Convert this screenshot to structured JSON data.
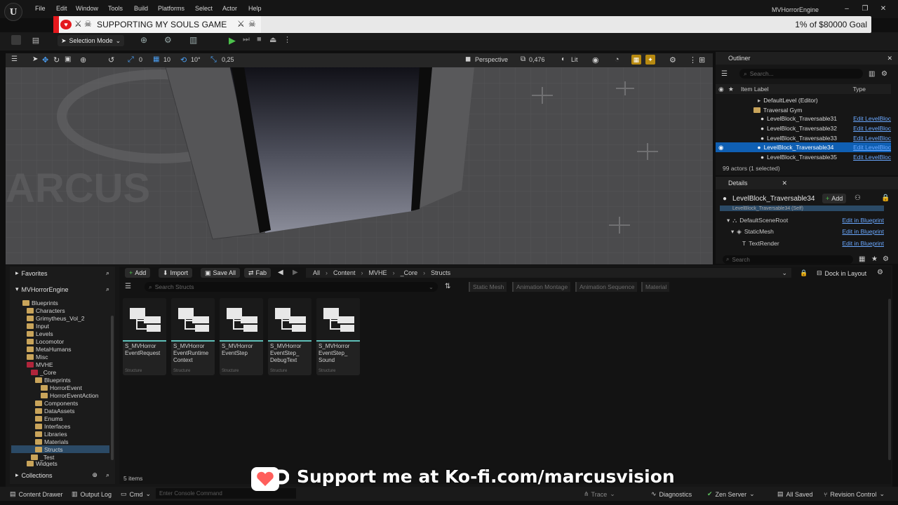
{
  "menu": {
    "items": [
      "File",
      "Edit",
      "Window",
      "Tools",
      "Build",
      "Platforms",
      "Select",
      "Actor",
      "Help"
    ],
    "app_title": "MVHorrorEngine"
  },
  "banner": {
    "title": "SUPPORTING MY SOULS GAME",
    "goal": "1% of $80000 Goal",
    "colors": {
      "accent": "#e4191d",
      "background": "#e8e8e8"
    }
  },
  "toolbar": {
    "selection_mode": "Selection Mode"
  },
  "viewport": {
    "snap_rotation": "0",
    "grid_size": "10",
    "rot_snap": "10°",
    "scale_snap": "0,25",
    "view_mode": "Perspective",
    "camera_speed": "0,476",
    "lighting": "Lit"
  },
  "outliner": {
    "title": "Outliner",
    "search_placeholder": "Search...",
    "col_label": "Item Label",
    "col_type": "Type",
    "level": "DefaultLevel (Editor)",
    "folder": "Traversal Gym",
    "rows": [
      {
        "label": "LevelBlock_Traversable31",
        "type": "Edit LevelBloc"
      },
      {
        "label": "LevelBlock_Traversable32",
        "type": "Edit LevelBloc"
      },
      {
        "label": "LevelBlock_Traversable33",
        "type": "Edit LevelBloc"
      },
      {
        "label": "LevelBlock_Traversable34",
        "type": "Edit LevelBloc"
      },
      {
        "label": "LevelBlock_Traversable35",
        "type": "Edit LevelBloc"
      }
    ],
    "footer": "99 actors (1 selected)"
  },
  "details": {
    "title": "Details",
    "actor": "LevelBlock_Traversable34",
    "add_label": "Add",
    "self_row": "LevelBlock_Traversable34 (Self)",
    "components": [
      {
        "name": "DefaultSceneRoot",
        "link": "Edit in Blueprint"
      },
      {
        "name": "StaticMesh",
        "link": "Edit in Blueprint"
      },
      {
        "name": "TextRender",
        "link": "Edit in Blueprint"
      }
    ],
    "search_placeholder": "Search"
  },
  "content_browser": {
    "favorites": "Favorites",
    "project": "MVHorrorEngine",
    "buttons": {
      "add": "Add",
      "import": "Import",
      "save_all": "Save All",
      "fab": "Fab"
    },
    "breadcrumb": [
      "All",
      "Content",
      "MVHE",
      "_Core",
      "Structs"
    ],
    "dock": "Dock in Layout",
    "search_placeholder": "Search Structs",
    "filters": [
      "Static Mesh",
      "Animation Montage",
      "Animation Sequence",
      "Material"
    ],
    "tree": [
      {
        "label": "Blueprints"
      },
      {
        "label": "Characters"
      },
      {
        "label": "Grimytheus_Vol_2"
      },
      {
        "label": "Input"
      },
      {
        "label": "Levels"
      },
      {
        "label": "Locomotor"
      },
      {
        "label": "MetaHumans"
      },
      {
        "label": "Misc"
      },
      {
        "label": "MVHE"
      },
      {
        "label": "_Core"
      },
      {
        "label": "Blueprints"
      },
      {
        "label": "HorrorEvent"
      },
      {
        "label": "HorrorEventAction"
      },
      {
        "label": "Components"
      },
      {
        "label": "DataAssets"
      },
      {
        "label": "Enums"
      },
      {
        "label": "Interfaces"
      },
      {
        "label": "Libraries"
      },
      {
        "label": "Materials"
      },
      {
        "label": "Structs"
      },
      {
        "label": "_Test"
      },
      {
        "label": "Widgets"
      }
    ],
    "assets": [
      {
        "name": "S_MVHorror EventRequest",
        "type": "Structure"
      },
      {
        "name": "S_MVHorror EventRuntime Context",
        "type": "Structure"
      },
      {
        "name": "S_MVHorror EventStep",
        "type": "Structure"
      },
      {
        "name": "S_MVHorror EventStep_ DebugText",
        "type": "Structure"
      },
      {
        "name": "S_MVHorror EventStep_ Sound",
        "type": "Structure"
      }
    ],
    "item_count": "5 items",
    "collections": "Collections"
  },
  "statusbar": {
    "content_drawer": "Content Drawer",
    "output_log": "Output Log",
    "cmd": "Cmd",
    "console_placeholder": "Enter Console Command",
    "trace": "Trace",
    "diagnostics": "Diagnostics",
    "zen": "Zen Server",
    "saved": "All Saved",
    "revision": "Revision Control"
  },
  "kofi": {
    "text": "Support me at Ko-fi.com/marcusvision",
    "colors": {
      "brand": "#ff5e5b"
    }
  }
}
